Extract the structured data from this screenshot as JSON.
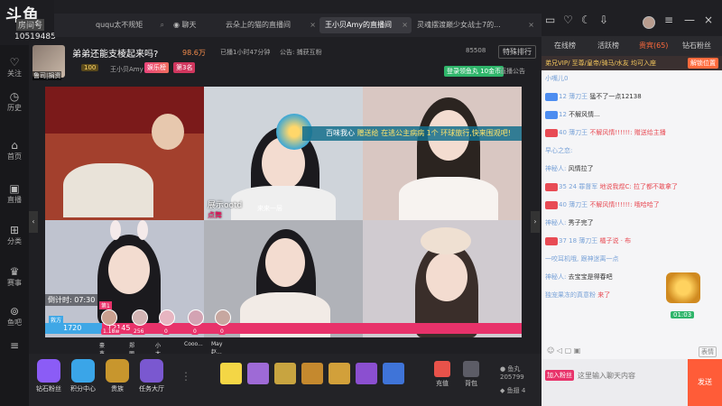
{
  "brand": {
    "logo": "斗鱼",
    "sub": "房间号",
    "room_number": "10519485"
  },
  "nav": [
    {
      "label": "关注",
      "icon": "heart-icon"
    },
    {
      "label": "历史",
      "icon": "clock-icon"
    },
    {
      "label": "首页",
      "icon": "home-icon"
    },
    {
      "label": "直播",
      "icon": "tv-icon"
    },
    {
      "label": "分类",
      "icon": "grid-icon"
    },
    {
      "label": "赛事",
      "icon": "trophy-icon"
    },
    {
      "label": "鱼吧",
      "icon": "fish-icon"
    },
    {
      "label": "",
      "icon": "menu-icon"
    }
  ],
  "tabs": [
    {
      "label": "ququ太不规矩",
      "active": false
    },
    {
      "label": "聊天",
      "active": false
    },
    {
      "label": "云朵上的猫的直播间",
      "active": false
    },
    {
      "label": "王小贝Amy的直播间",
      "active": true
    },
    {
      "label": "灵魂摆渡巅少女战士7的...",
      "active": false
    }
  ],
  "window": {
    "icons": [
      "message-icon",
      "heart-icon",
      "moon-icon",
      "download-icon",
      "avatar",
      "menu-icon",
      "minimize-icon",
      "close-icon"
    ]
  },
  "room": {
    "title": "弟弟还能支棱起来吗?",
    "avatar_label": "鲁司|捐资",
    "fire": "98.6万",
    "live_time": "已播1小时47分钟",
    "notice": "公告: 捕获互粉",
    "room_id": "85508",
    "ranking": "特殊排行",
    "level": "100",
    "anchor": "王小贝Amy",
    "ent_badge": "娱乐榜",
    "ent_rank": "第3名",
    "login_btn": "登录领鱼丸 10金币",
    "announce": "直播公告"
  },
  "video": {
    "banner_user": "百味我心",
    "banner_text": "赠送给 在逃公主病病 1个 环球旅行,快来围观吧!",
    "tile_title": "展示ootd",
    "tile_sub": "点舞",
    "tile_lai": "来来一层",
    "countdown": "倒计时: 07:30",
    "pk_left": "1720",
    "pk_right": "12145",
    "pk_left_share": 0.12,
    "pk_users": [
      {
        "value": "1.18w",
        "name": "豪鑫"
      },
      {
        "value": "256",
        "name": "郑丽秀"
      },
      {
        "value": "0",
        "name": "小太阳..."
      },
      {
        "value": "0",
        "name": "Cooo..."
      },
      {
        "value": "0",
        "name": "May赵..."
      }
    ],
    "pk_first": "第1",
    "pk_blue_badge": "救方"
  },
  "giftbar": {
    "actions": [
      {
        "label": "钻石粉丝",
        "color": "#8b5cf6"
      },
      {
        "label": "积分中心",
        "color": "#3aa5e8"
      },
      {
        "label": "贵族",
        "color": "#c8962d"
      },
      {
        "label": "任务大厅",
        "color": "#7a58d0"
      }
    ],
    "gifts": [
      "#f4d645",
      "#9e6ad6",
      "#c8a440",
      "#c5892e",
      "#d2a03a",
      "#8b4fd0",
      "#3f74d8"
    ],
    "recharge": "充值",
    "bag": "背包",
    "fishball": "鱼丸",
    "fishball_val": "205799",
    "fishwing": "鱼翅",
    "fishwing_val": "4"
  },
  "chat": {
    "tabs": [
      {
        "label": "在线榜",
        "active": false
      },
      {
        "label": "活跃榜",
        "active": false
      },
      {
        "label": "贵宾(65)",
        "active": true
      },
      {
        "label": "钻石粉丝",
        "active": false
      }
    ],
    "banner": "弟兄VIP/ 至尊/皇帝/骑马/水友 均可入座",
    "banner_btn": "解锁位置",
    "messages": [
      {
        "u": "小嘴儿0",
        "t": "",
        "red": false
      },
      {
        "u": "",
        "badge": "12 薄刀王",
        "t": "猛不了一点12138",
        "red": false
      },
      {
        "u": "",
        "badge": "12",
        "t": "不解风情...",
        "red": false
      },
      {
        "u": "",
        "badge": "40 薄刀王",
        "t": "不解风情!!!!!!:  赠送给主播",
        "red": true
      },
      {
        "u": "早心之恋:",
        "t": "",
        "red": false
      },
      {
        "u": "神秘人:",
        "t": "风情拉了",
        "red": false
      },
      {
        "u": "",
        "badge": "35 24 罪督军",
        "t": "地说我煜C: 拉了都不敢拿了",
        "red": true
      },
      {
        "u": "",
        "badge": "40 薄刀王",
        "t": "不解风情!!!!!!: 哦哈哈了",
        "red": true
      },
      {
        "u": "神秘人:",
        "t": "秀子完了",
        "red": false
      },
      {
        "u": "",
        "badge": "37 18 薄刀王",
        "t": "橘子说 · 布",
        "red": true
      },
      {
        "u": "一咬耳机哦, 跟神迷离一点",
        "t": "",
        "red": false
      },
      {
        "u": "神秘人:",
        "t": "去宝宝是得春吧",
        "red": false
      },
      {
        "u": "独宠果冻的真意粉",
        "t": "来了",
        "red": true
      }
    ],
    "ad_time": "01:03",
    "tools_badge": "表情",
    "fan_badge": "加入粉丝",
    "input_placeholder": "这里输入聊天内容",
    "send": "发送"
  }
}
